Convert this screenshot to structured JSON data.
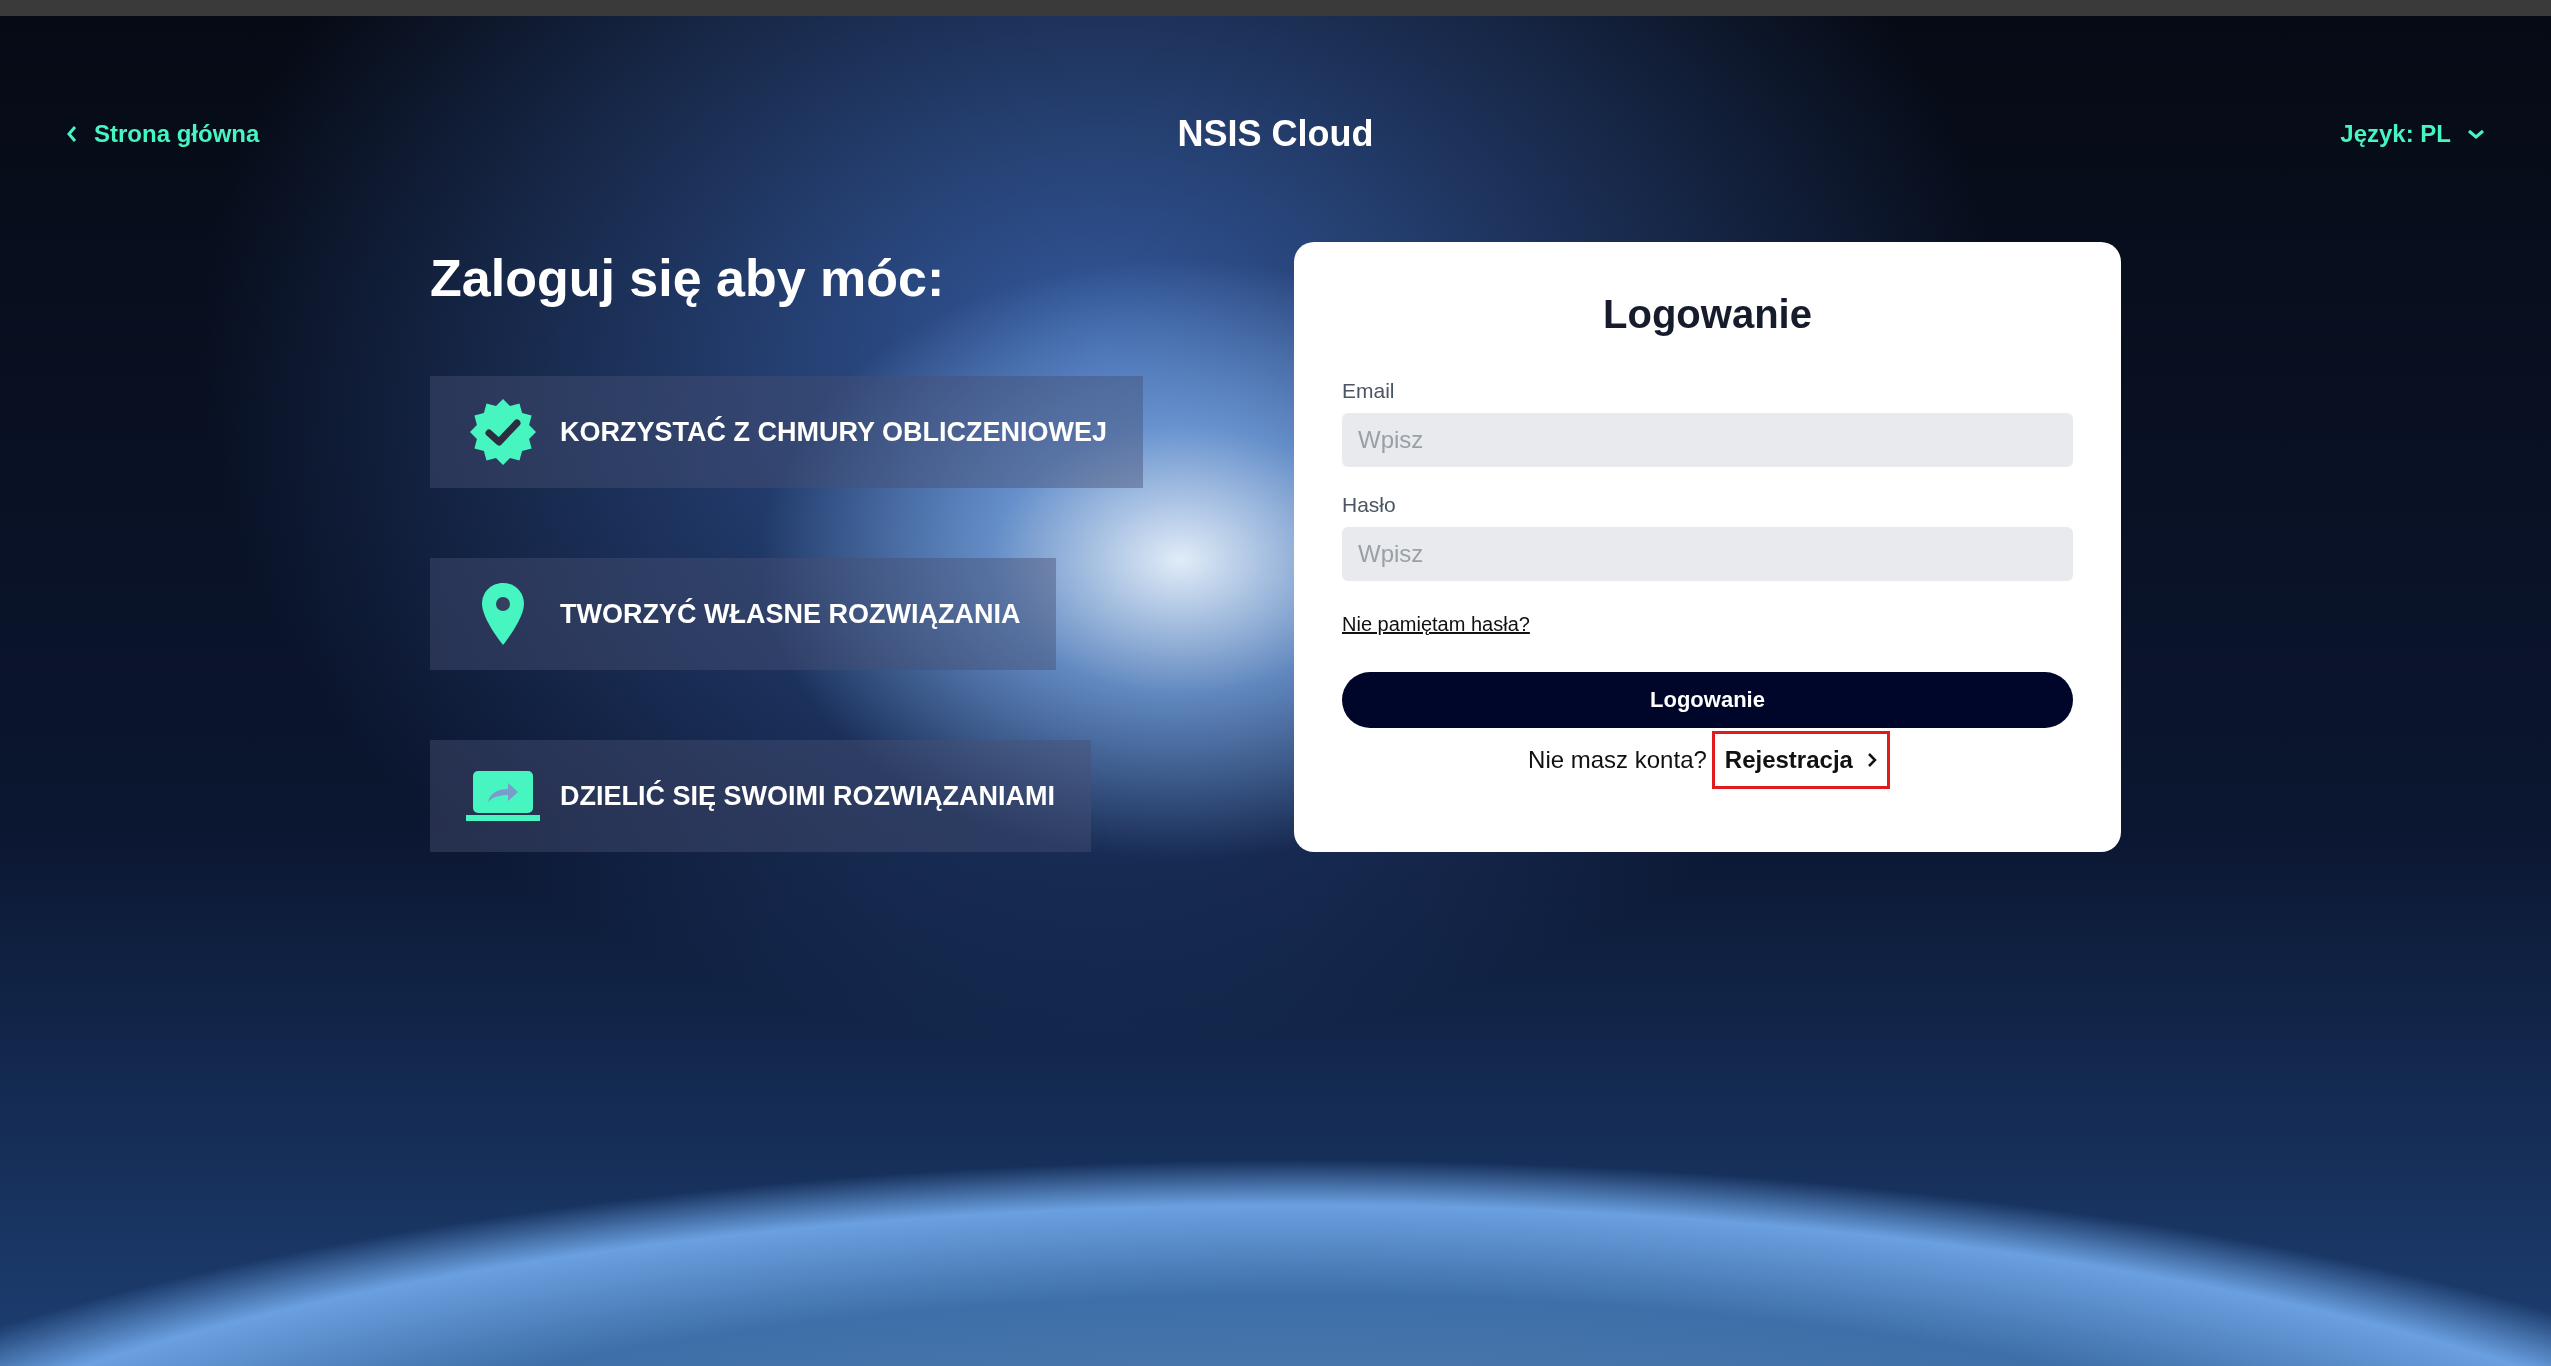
{
  "header": {
    "back_link": "Strona główna",
    "title": "NSIS Cloud",
    "language": "Język: PL"
  },
  "intro": {
    "heading": "Zaloguj się aby móc:",
    "features": [
      {
        "kind": "badge",
        "label": "KORZYSTAĆ Z CHMURY OBLICZENIOWEJ"
      },
      {
        "kind": "pin",
        "label": "TWORZYĆ WŁASNE ROZWIĄZANIA"
      },
      {
        "kind": "laptop",
        "label": "DZIELIĆ SIĘ SWOIMI ROZWIĄZANIAMI"
      }
    ]
  },
  "login": {
    "title": "Logowanie",
    "fields": [
      {
        "label": "Email",
        "placeholder": "Wpisz"
      },
      {
        "label": "Hasło",
        "placeholder": "Wpisz"
      }
    ],
    "forgot_link": "Nie pamiętam hasła?",
    "submit": "Logowanie",
    "signup_prompt": "Nie masz konta?",
    "signup_link": {
      "label": "Rejestracja",
      "highlighted": true
    }
  }
}
